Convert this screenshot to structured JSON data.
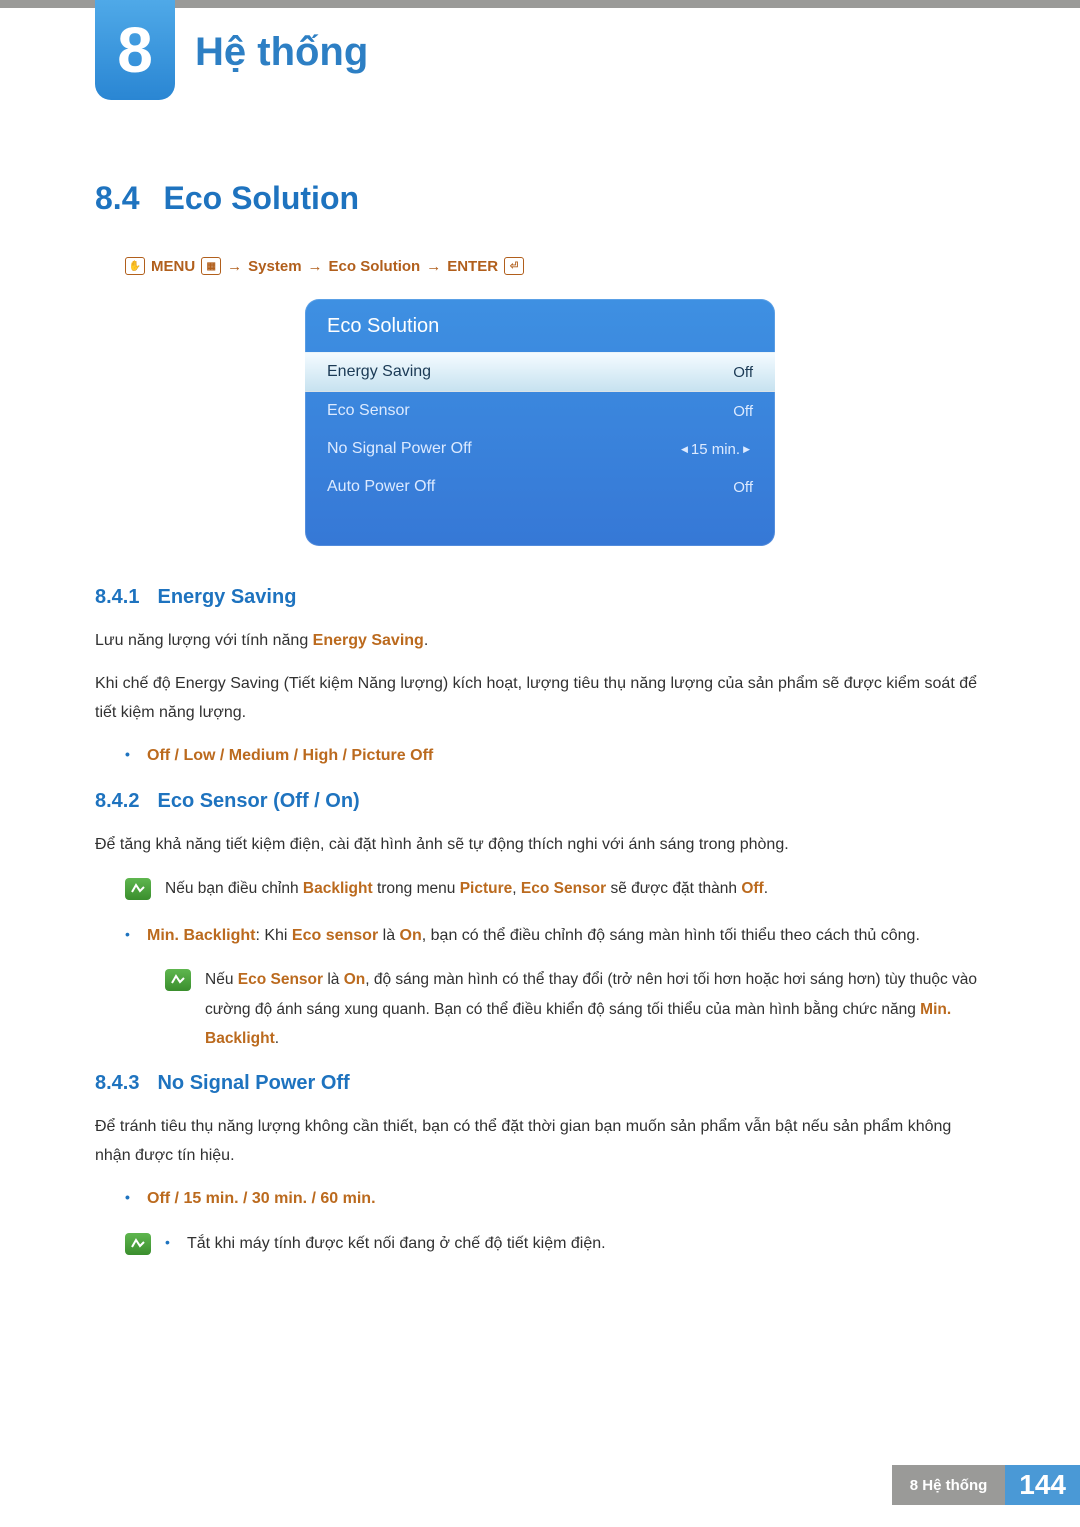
{
  "chapter": {
    "number": "8",
    "title": "Hệ thống"
  },
  "section": {
    "number": "8.4",
    "title": "Eco Solution"
  },
  "nav_path": {
    "menu": "MENU",
    "arrow": "→",
    "p1": "System",
    "p2": "Eco Solution",
    "enter": "ENTER"
  },
  "osd": {
    "title": "Eco Solution",
    "rows": [
      {
        "label": "Energy Saving",
        "value": "Off",
        "selected": true
      },
      {
        "label": "Eco Sensor",
        "value": "Off",
        "selected": false
      },
      {
        "label": "No Signal Power Off",
        "value": "15 min.",
        "selected": false,
        "arrows": true
      },
      {
        "label": "Auto Power Off",
        "value": "Off",
        "selected": false
      }
    ]
  },
  "s841": {
    "num": "8.4.1",
    "title": "Energy Saving",
    "p1a": "Lưu năng lượng với tính năng ",
    "p1b": "Energy Saving",
    "p1c": ".",
    "p2": "Khi chế độ Energy Saving (Tiết kiệm Năng lượng) kích hoạt, lượng tiêu thụ năng lượng của sản phẩm sẽ được kiểm soát để tiết kiệm năng lượng.",
    "options": "Off / Low / Medium / High / Picture Off"
  },
  "s842": {
    "num": "8.4.2",
    "title": "Eco Sensor (Off / On)",
    "p1": "Để tăng khả năng tiết kiệm điện, cài đặt hình ảnh sẽ tự động thích nghi với ánh sáng trong phòng.",
    "note1_a": "Nếu bạn điều chỉnh ",
    "note1_b": "Backlight",
    "note1_c": " trong menu ",
    "note1_d": "Picture",
    "note1_e": ", ",
    "note1_f": "Eco Sensor",
    "note1_g": " sẽ được đặt thành ",
    "note1_h": "Off",
    "note1_i": ".",
    "bullet_a": "Min. Backlight",
    "bullet_b": ": Khi ",
    "bullet_c": "Eco sensor",
    "bullet_d": " là ",
    "bullet_e": "On",
    "bullet_f": ", bạn có thể điều chỉnh độ sáng màn hình tối thiểu theo cách thủ công.",
    "note2_a": "Nếu ",
    "note2_b": "Eco Sensor",
    "note2_c": " là ",
    "note2_d": "On",
    "note2_e": ", độ sáng màn hình có thể thay đổi (trở nên hơi tối hơn hoặc hơi sáng hơn) tùy thuộc vào cường độ ánh sáng xung quanh. Bạn có thể điều khiển độ sáng tối thiểu của màn hình bằng chức năng ",
    "note2_f": "Min. Backlight",
    "note2_g": "."
  },
  "s843": {
    "num": "8.4.3",
    "title": "No Signal Power Off",
    "p1": "Để tránh tiêu thụ năng lượng không cần thiết, bạn có thể đặt thời gian bạn muốn sản phẩm vẫn bật nếu sản phẩm không nhận được tín hiệu.",
    "options": "Off / 15 min. / 30 min. / 60 min.",
    "note": "Tắt khi máy tính được kết nối đang ở chế độ tiết kiệm điện."
  },
  "footer": {
    "crumb": "8 Hệ thống",
    "page": "144"
  }
}
